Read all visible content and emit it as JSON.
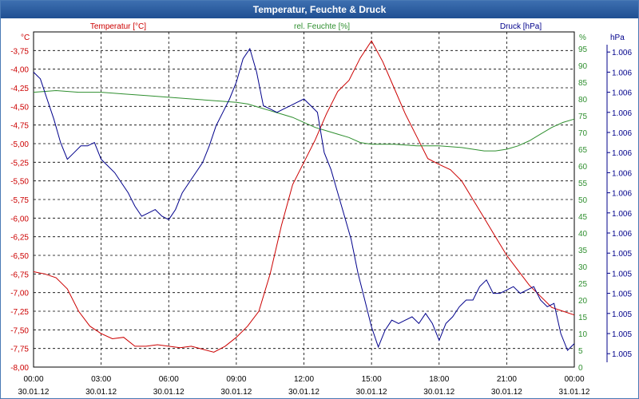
{
  "window": {
    "title": "Temperatur, Feuchte & Druck"
  },
  "chart_data": {
    "type": "line",
    "title": "Temperatur, Feuchte & Druck",
    "grid": true,
    "legend": "top",
    "x_ticks": [
      {
        "time": "00:00",
        "date": "30.01.12"
      },
      {
        "time": "03:00",
        "date": "30.01.12"
      },
      {
        "time": "06:00",
        "date": "30.01.12"
      },
      {
        "time": "09:00",
        "date": "30.01.12"
      },
      {
        "time": "12:00",
        "date": "30.01.12"
      },
      {
        "time": "15:00",
        "date": "30.01.12"
      },
      {
        "time": "18:00",
        "date": "30.01.12"
      },
      {
        "time": "21:00",
        "date": "30.01.12"
      },
      {
        "time": "00:00",
        "date": "31.01.12"
      }
    ],
    "x_range_hours": [
      0,
      24
    ],
    "axes": {
      "temperature": {
        "unit": "°C",
        "ylim": [
          -8.0,
          -3.5
        ],
        "ticks": [
          "-3,75",
          "-4,00",
          "-4,25",
          "-4,50",
          "-4,75",
          "-5,00",
          "-5,25",
          "-5,50",
          "-5,75",
          "-6,00",
          "-6,25",
          "-6,50",
          "-6,75",
          "-7,00",
          "-7,25",
          "-7,50",
          "-7,75",
          "-8,00"
        ],
        "tick_values": [
          -3.75,
          -4.0,
          -4.25,
          -4.5,
          -4.75,
          -5.0,
          -5.25,
          -5.5,
          -5.75,
          -6.0,
          -6.25,
          -6.5,
          -6.75,
          -7.0,
          -7.25,
          -7.5,
          -7.75,
          -8.0
        ]
      },
      "humidity": {
        "unit": "%",
        "ylim": [
          0,
          100
        ],
        "ticks": [
          "95",
          "90",
          "85",
          "80",
          "75",
          "70",
          "65",
          "60",
          "55",
          "50",
          "45",
          "40",
          "35",
          "30",
          "25",
          "20",
          "15",
          "10",
          "5",
          "0"
        ],
        "tick_values": [
          95,
          90,
          85,
          80,
          75,
          70,
          65,
          60,
          55,
          50,
          45,
          40,
          35,
          30,
          25,
          20,
          15,
          10,
          5,
          0
        ]
      },
      "pressure": {
        "unit": "hPa",
        "ylim": [
          0,
          100
        ],
        "ticks": [
          "1.006",
          "1.006",
          "1.006",
          "1.006",
          "1.006",
          "1.006",
          "1.006",
          "1.006",
          "1.006",
          "1.006",
          "1.005",
          "1.005",
          "1.005",
          "1.005",
          "1.005",
          "1.005",
          "1.005"
        ],
        "tick_values": [
          94,
          88,
          82,
          76,
          70,
          64,
          58,
          52,
          46,
          40,
          34,
          28,
          22,
          16,
          10,
          4
        ]
      }
    },
    "series": [
      {
        "name": "Temperatur [°C]",
        "axis": "temperature",
        "color": "#cc0000",
        "x": [
          0,
          0.5,
          1,
          1.5,
          2,
          2.5,
          3,
          3.5,
          4,
          4.5,
          5,
          5.5,
          6,
          6.5,
          7,
          7.5,
          8,
          8.5,
          9,
          9.5,
          10,
          10.5,
          11,
          11.5,
          12,
          12.5,
          13,
          13.5,
          14,
          14.5,
          15,
          15.5,
          16,
          16.5,
          17,
          17.5,
          18,
          18.5,
          19,
          19.5,
          20,
          20.5,
          21,
          21.5,
          22,
          22.5,
          23,
          23.5,
          24
        ],
        "y": [
          -6.72,
          -6.75,
          -6.8,
          -6.95,
          -7.25,
          -7.45,
          -7.55,
          -7.62,
          -7.6,
          -7.72,
          -7.72,
          -7.7,
          -7.72,
          -7.74,
          -7.72,
          -7.76,
          -7.8,
          -7.72,
          -7.6,
          -7.45,
          -7.25,
          -6.75,
          -6.1,
          -5.55,
          -5.25,
          -4.95,
          -4.6,
          -4.3,
          -4.15,
          -3.85,
          -3.62,
          -3.9,
          -4.25,
          -4.6,
          -4.9,
          -5.2,
          -5.28,
          -5.35,
          -5.5,
          -5.75,
          -6.0,
          -6.25,
          -6.5,
          -6.7,
          -6.9,
          -7.05,
          -7.2,
          -7.25,
          -7.3
        ]
      },
      {
        "name": "rel. Feuchte [%]",
        "axis": "humidity",
        "color": "#2f8f2f",
        "x": [
          0,
          1,
          2,
          3,
          4,
          5,
          6,
          7,
          8,
          9,
          9.5,
          10,
          10.5,
          11,
          11.5,
          12,
          12.5,
          13,
          13.5,
          14,
          14.5,
          15,
          16,
          17,
          18,
          19,
          20,
          20.5,
          21,
          21.5,
          22,
          22.5,
          23,
          23.5,
          24
        ],
        "y": [
          82,
          82.5,
          82,
          82,
          81.5,
          81,
          80.5,
          80,
          79.5,
          79,
          78.5,
          77.5,
          76.5,
          75.5,
          74.5,
          73,
          71.5,
          70.5,
          69.5,
          68.5,
          67,
          66.5,
          66.5,
          66,
          66,
          65.5,
          64.5,
          64.5,
          65,
          66,
          67.5,
          69.5,
          71.5,
          73,
          74
        ]
      },
      {
        "name": "Druck [hPa]",
        "axis": "pressure",
        "color": "#00008b",
        "x": [
          0,
          0.3,
          0.6,
          0.9,
          1.2,
          1.5,
          1.8,
          2.1,
          2.4,
          2.7,
          3,
          3.3,
          3.6,
          3.9,
          4.2,
          4.5,
          4.8,
          5.1,
          5.4,
          5.7,
          6,
          6.3,
          6.6,
          6.9,
          7.2,
          7.5,
          7.8,
          8.1,
          8.4,
          8.7,
          9,
          9.3,
          9.6,
          9.9,
          10.2,
          10.5,
          10.8,
          11.1,
          11.4,
          11.7,
          12,
          12.3,
          12.6,
          12.9,
          13.2,
          13.5,
          13.8,
          14.1,
          14.4,
          14.7,
          15,
          15.3,
          15.6,
          15.9,
          16.2,
          16.5,
          16.8,
          17.1,
          17.4,
          17.7,
          18,
          18.3,
          18.6,
          18.9,
          19.2,
          19.5,
          19.8,
          20.1,
          20.4,
          20.7,
          21,
          21.3,
          21.6,
          21.9,
          22.2,
          22.5,
          22.8,
          23.1,
          23.4,
          23.7,
          24
        ],
        "y": [
          88,
          86,
          80,
          74,
          67,
          62,
          64,
          66,
          66,
          67,
          62,
          60,
          58,
          55,
          52,
          48,
          45,
          46,
          47,
          45,
          44,
          47,
          52,
          55,
          58,
          61,
          66,
          72,
          76,
          80,
          85,
          92,
          95,
          88,
          78,
          77,
          76,
          77,
          78,
          79,
          80,
          78,
          76,
          64,
          59,
          52,
          45,
          38,
          28,
          20,
          12,
          6,
          11,
          14,
          13,
          14,
          15,
          13,
          16,
          13,
          8,
          13,
          15,
          18,
          20,
          20,
          24,
          26,
          22,
          22,
          23,
          24,
          22,
          23,
          24,
          20,
          18,
          19,
          10,
          5,
          7
        ]
      }
    ]
  }
}
